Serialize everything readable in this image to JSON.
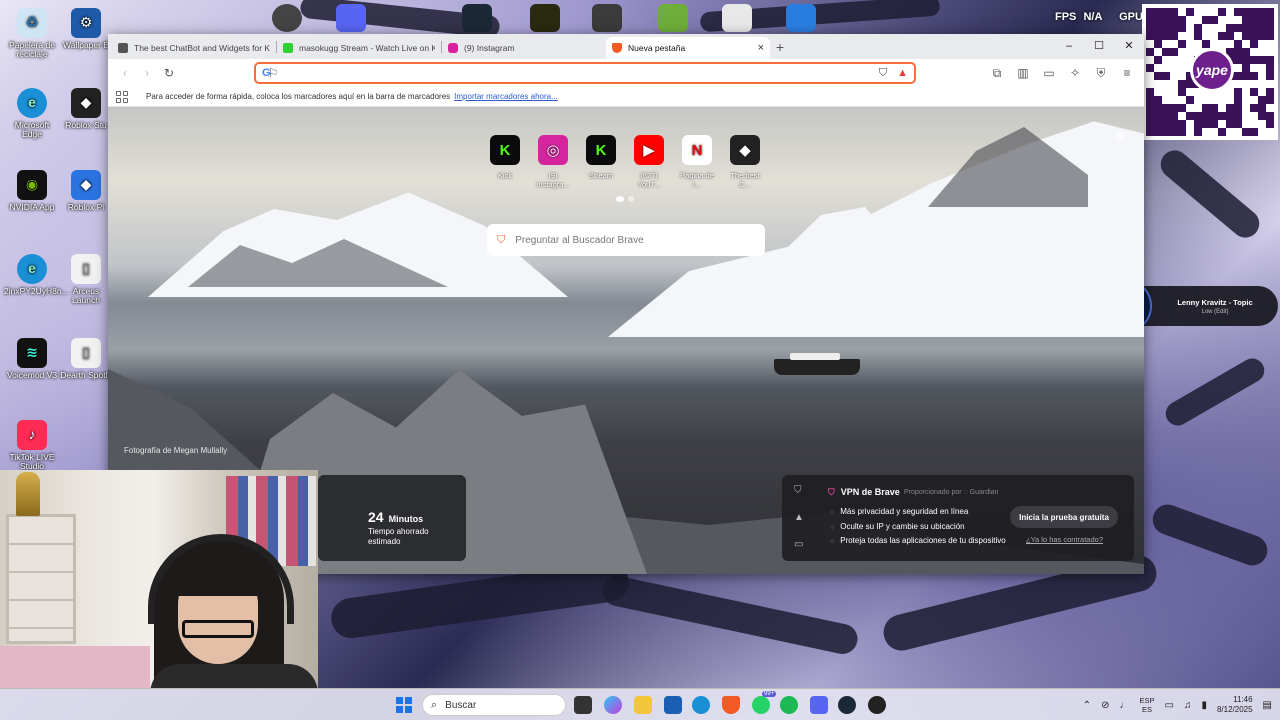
{
  "desktop": {
    "icons": [
      {
        "label": "Papelera de reciclaje",
        "name": "recycle-bin"
      },
      {
        "label": "Wallpaper E",
        "name": "wallpaper-engine"
      },
      {
        "label": "Microsoft Edge",
        "name": "edge"
      },
      {
        "label": "Roblox Stu",
        "name": "roblox-studio"
      },
      {
        "label": "NVIDIA App",
        "name": "nvidia-app"
      },
      {
        "label": "Roblox Pl",
        "name": "roblox-player"
      },
      {
        "label": "2inxPY2UyH8n...",
        "name": "shortcut"
      },
      {
        "label": "Arceus Launch",
        "name": "arceus"
      },
      {
        "label": "Voicemod V3",
        "name": "voicemod"
      },
      {
        "label": "Dearth Spotly",
        "name": "dearth"
      },
      {
        "label": "TikTok LIVE Studio",
        "name": "tiktok-live"
      }
    ],
    "fps_label": "FPS",
    "fps_value": "N/A",
    "gpu_label": "GPU"
  },
  "browser": {
    "tabs": [
      {
        "title": "The best ChatBot and Widgets for Ki...",
        "color": "#555555"
      },
      {
        "title": "masokugg Stream - Watch Live on Ki...",
        "color": "#2fd12f"
      },
      {
        "title": "(9) Instagram",
        "color": "#d6249f"
      },
      {
        "title": "Nueva pestaña",
        "color": "#f25a23"
      }
    ],
    "new_tab_symbol": "+",
    "close_tab_symbol": "×",
    "window_controls": {
      "minimize": "–",
      "maximize": "☐",
      "close": "✕"
    },
    "address": {
      "value": "",
      "placeholder": ""
    },
    "bookmarks_message": "Para acceder de forma rápida, coloca los marcadores aquí en la barra de marcadores",
    "bookmarks_link": "Importar marcadores ahora..."
  },
  "newtab": {
    "top_sites": [
      {
        "label": "Kick",
        "glyph": "K",
        "bg": "#0b0b0b",
        "fg": "#53fc18"
      },
      {
        "label": "(9) Instagra...",
        "glyph": "◎",
        "bg": "#d6249f",
        "fg": "#ffffff"
      },
      {
        "label": "Stream",
        "glyph": "K",
        "bg": "#0b0b0b",
        "fg": "#53fc18"
      },
      {
        "label": "(627) YouT...",
        "glyph": "▶",
        "bg": "#ff0000",
        "fg": "#ffffff"
      },
      {
        "label": "Página de i...",
        "glyph": "N",
        "bg": "#ffffff",
        "fg": "#e50914"
      },
      {
        "label": "The best C...",
        "glyph": "◆",
        "bg": "#222222",
        "fg": "#ffffff"
      }
    ],
    "search_placeholder": "Preguntar al Buscador Brave",
    "photo_credit": "Fotografía de Megan Mullally",
    "stats": {
      "number": "24",
      "unit": "Minutos",
      "desc": "Tiempo ahorrado estimado"
    },
    "vpn": {
      "title": "VPN de Brave",
      "provider": "Proporcionado por ◌ Guardian",
      "features": [
        "Más privacidad y seguridad en línea",
        "Oculte su IP y cambie su ubicación",
        "Proteja todas las aplicaciones de tu dispositivo"
      ],
      "trial_button": "Inicia la prueba gratuita",
      "have_link": "¿Ya lo has contratado?"
    }
  },
  "music_widget": {
    "title": "Lenny Kravitz - Topic",
    "subtitle": "Low (Edit)"
  },
  "qr": {
    "logo_text": "yape"
  },
  "taskbar": {
    "search_label": "Buscar",
    "badge_whatsapp": "99+",
    "lang_top": "ESP",
    "lang_bottom": "ES",
    "time": "11:46",
    "date": "8/12/2025"
  }
}
